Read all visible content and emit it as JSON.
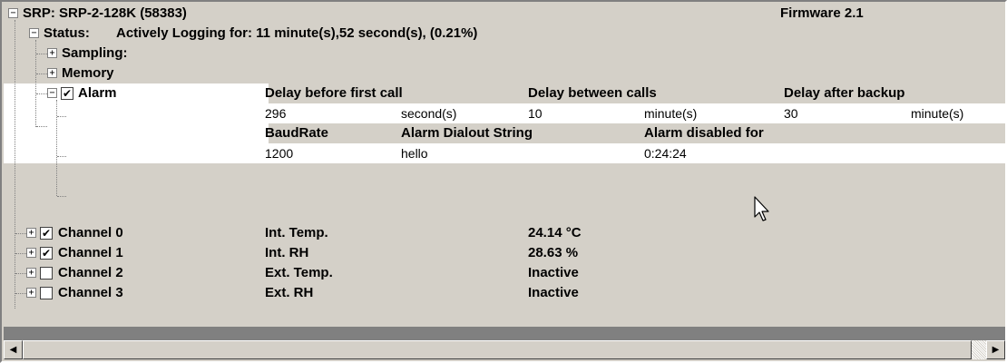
{
  "srp": {
    "title": "SRP: SRP-2-128K (58383)",
    "firmware": "Firmware 2.1"
  },
  "status": {
    "label": "Status:",
    "value": "Actively Logging for: 11 minute(s),52 second(s), (0.21%)"
  },
  "tree": {
    "sampling": "Sampling:",
    "memory": "Memory",
    "alarm": "Alarm"
  },
  "alarm": {
    "delay_first_header": "Delay before first call",
    "delay_between_header": "Delay between calls",
    "delay_after_header": "Delay after backup",
    "delay_first_value": "296",
    "delay_first_unit": "second(s)",
    "delay_between_value": "10",
    "delay_between_unit": "minute(s)",
    "delay_after_value": "30",
    "delay_after_unit": "minute(s)",
    "baud_header": "BaudRate",
    "dialout_header": "Alarm Dialout String",
    "disabled_header": "Alarm disabled for",
    "baud_value": "1200",
    "dialout_value": "hello",
    "disabled_value": "0:24:24",
    "checked": true
  },
  "channels": [
    {
      "name": "Channel 0",
      "sensor": "Int. Temp.",
      "reading": "24.14 °C",
      "checked": true
    },
    {
      "name": "Channel 1",
      "sensor": "Int. RH",
      "reading": "28.63 %",
      "checked": true
    },
    {
      "name": "Channel 2",
      "sensor": "Ext. Temp.",
      "reading": "Inactive",
      "checked": false
    },
    {
      "name": "Channel 3",
      "sensor": "Ext. RH",
      "reading": "Inactive",
      "checked": false
    }
  ],
  "icons": {
    "expand": "plus-box-icon",
    "collapse": "minus-box-icon",
    "check": "checkmark-icon",
    "scroll_left": "arrow-left-icon",
    "scroll_right": "arrow-right-icon",
    "cursor": "mouse-pointer-icon"
  }
}
